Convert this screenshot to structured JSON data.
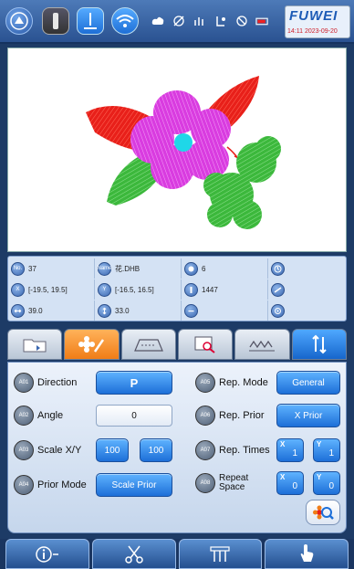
{
  "brand": {
    "name": "FUWEI",
    "datetime": "14:11 2023-09-20"
  },
  "info": {
    "rows": [
      [
        {
          "badge": "No.",
          "value": "37"
        },
        {
          "badge": "Name",
          "value": "花.DHB"
        },
        {
          "badge": "",
          "value": "6"
        },
        {
          "badge": "",
          "value": ""
        }
      ],
      [
        {
          "badge": "X",
          "value": "[-19.5, 19.5]"
        },
        {
          "badge": "Y",
          "value": "[-16.5, 16.5]"
        },
        {
          "badge": "",
          "value": "1447"
        },
        {
          "badge": "",
          "value": ""
        }
      ],
      [
        {
          "badge": "",
          "value": "39.0"
        },
        {
          "badge": "",
          "value": "33.0"
        },
        {
          "badge": "",
          "value": ""
        },
        {
          "badge": "",
          "value": ""
        }
      ]
    ]
  },
  "params": {
    "a01": {
      "badge": "A01",
      "label": "Direction",
      "value": "P"
    },
    "a02": {
      "badge": "A02",
      "label": "Angle",
      "value": "0"
    },
    "a03": {
      "badge": "A03",
      "label": "Scale X/Y",
      "x": "100",
      "y": "100"
    },
    "a04": {
      "badge": "A04",
      "label": "Prior Mode",
      "value": "Scale Prior"
    },
    "a05": {
      "badge": "A05",
      "label": "Rep. Mode",
      "value": "General"
    },
    "a06": {
      "badge": "A06",
      "label": "Rep. Prior",
      "value": "X Prior"
    },
    "a07": {
      "badge": "A07",
      "label": "Rep. Times",
      "x_tag": "X",
      "x": "1",
      "y_tag": "Y",
      "y": "1"
    },
    "a08": {
      "badge": "A08",
      "label_line1": "Repeat",
      "label_line2": "Space",
      "x_tag": "X",
      "x": "0",
      "y_tag": "Y",
      "y": "0"
    }
  },
  "colors": {
    "accent": "#1d6fd8",
    "active_tab": "#f07d17",
    "flower_red": "#e8201a",
    "flower_magenta": "#d93ce0",
    "flower_green": "#3cb83c",
    "flower_cyan": "#1fd7e8"
  }
}
